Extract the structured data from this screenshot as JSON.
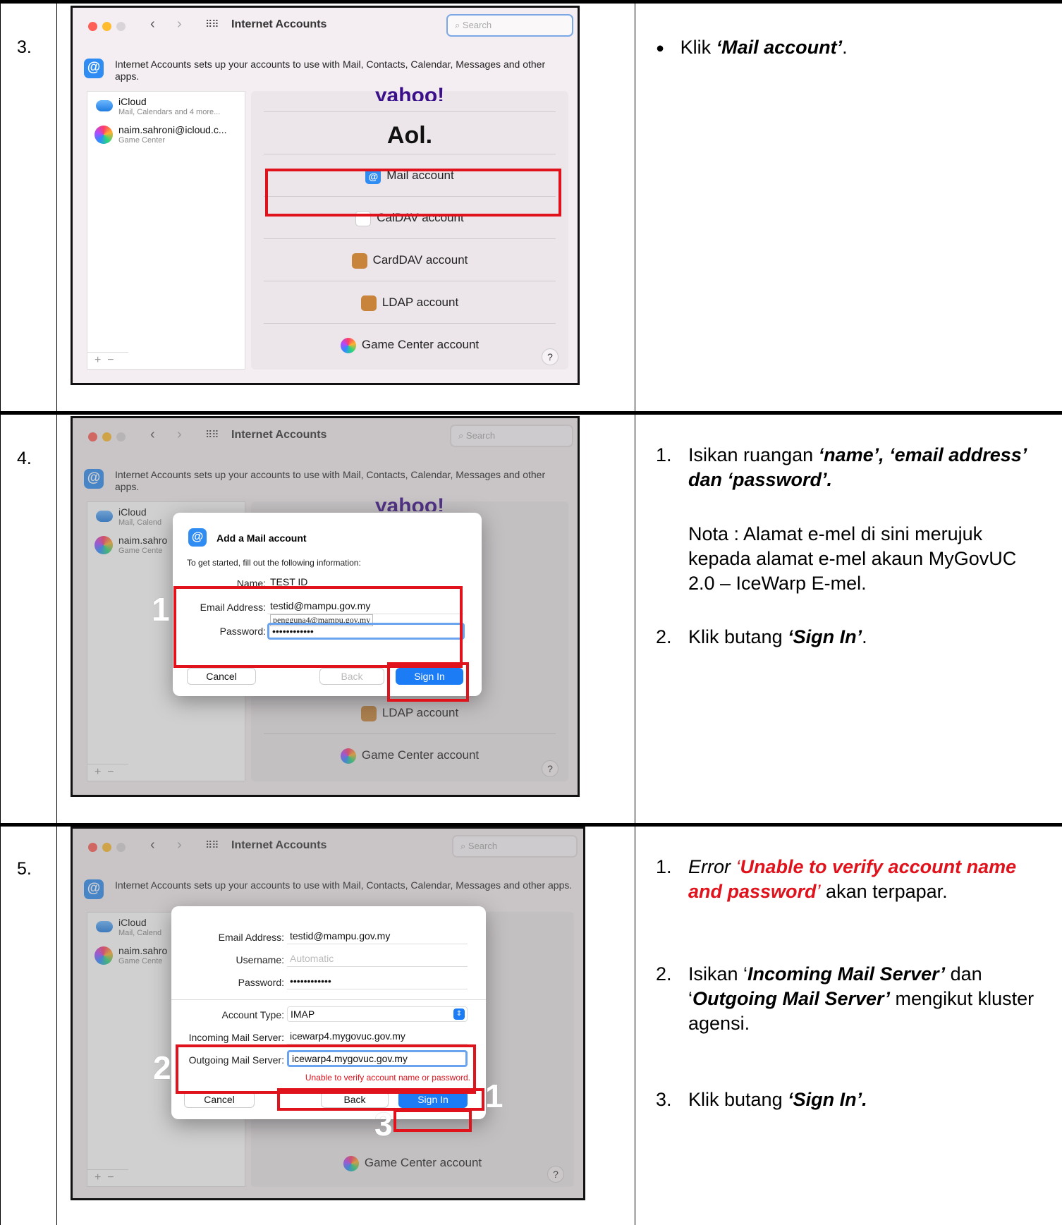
{
  "app_title": "Internet Accounts",
  "search_placeholder": "Search",
  "intro_text": "Internet Accounts sets up your accounts to use with Mail, Contacts, Calendar, Messages and other apps.",
  "sidebar": {
    "icloud": {
      "name": "iCloud",
      "sub": "Mail, Calendars and 4 more...",
      "sub_short": "Mail, Calend"
    },
    "gamecenter": {
      "name": "naim.sahroni@icloud.c...",
      "name_short": "naim.sahro",
      "sub": "Game Center",
      "sub_short": "Game Cente"
    },
    "plus": "+",
    "minus": "−"
  },
  "providers": {
    "yahoo": "yahoo!",
    "aol": "Aol.",
    "mail": "Mail account",
    "caldav": "CalDAV account",
    "carddav": "CardDAV account",
    "ldap": "LDAP account",
    "gamecenter": "Game Center account",
    "help": "?"
  },
  "steps": [
    {
      "number": "3.",
      "desc": {
        "bullet": "●",
        "pre": "Klik ",
        "bold": "‘Mail account’",
        "post": "."
      }
    },
    {
      "number": "4.",
      "dialog": {
        "title": "Add a Mail account",
        "subtitle": "To get started, fill out the following information:",
        "name_label": "Name:",
        "name_value": "TEST ID",
        "email_label": "Email Address:",
        "email_value": "testid@mampu.gov.my",
        "autocomplete": "pengguna4@mampu.gov.my",
        "password_label": "Password:",
        "password_value": "••••••••••••",
        "cancel": "Cancel",
        "back": "Back",
        "signin": "Sign In",
        "marker": "1"
      },
      "desc": {
        "item1_num": "1.",
        "item1_pre": "Isikan ruangan ",
        "item1_bold": "‘name’, ‘email address’ dan ‘password’.",
        "note": "Nota : Alamat e-mel di sini merujuk kepada alamat e-mel akaun MyGovUC 2.0 – IceWarp E-mel.",
        "item2_num": "2.",
        "item2_pre": "Klik butang ",
        "item2_bold": "‘Sign In’",
        "item2_post": "."
      }
    },
    {
      "number": "5.",
      "dialog": {
        "email_label": "Email Address:",
        "email_value": "testid@mampu.gov.my",
        "username_label": "Username:",
        "username_value": "Automatic",
        "password_label": "Password:",
        "password_value": "••••••••••••",
        "type_label": "Account Type:",
        "type_value": "IMAP",
        "incoming_label": "Incoming Mail Server:",
        "incoming_value": "icewarp4.mygovuc.gov.my",
        "outgoing_label": "Outgoing Mail Server:",
        "outgoing_value": "icewarp4.mygovuc.gov.my",
        "error": "Unable to verify account name or password.",
        "cancel": "Cancel",
        "back": "Back",
        "signin": "Sign In",
        "marker1": "1",
        "marker2": "2",
        "marker3": "3"
      },
      "desc": {
        "item1_num": "1.",
        "item1_pre": "Error ",
        "item1_red": "Unable to verify account name and password",
        "item1_post": " akan terpapar.",
        "item2_num": "2.",
        "item2_a": "Isikan ‘",
        "item2_b1": "Incoming Mail Server’",
        "item2_c": " dan ‘",
        "item2_b2": "Outgoing Mail Server’",
        "item2_d": " mengikut kluster agensi.",
        "item3_num": "3.",
        "item3_pre": "Klik butang ",
        "item3_bold": "‘Sign In’."
      }
    }
  ],
  "colors": {
    "accent": "#1b7cf5",
    "highlight": "#e0121b"
  }
}
